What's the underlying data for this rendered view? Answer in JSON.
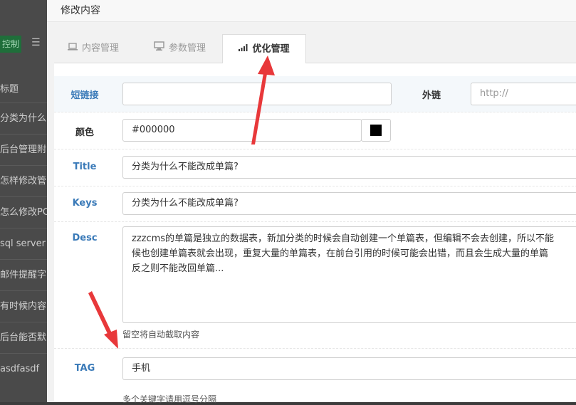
{
  "background": {
    "button_label": "控制",
    "column_header": "标题",
    "rows": [
      "分类为什么",
      "后台管理附",
      "怎样修改管",
      "怎么修改PC",
      "sql server",
      "邮件提醒字",
      "有时候内容",
      "后台能否默",
      "asdfasdf"
    ]
  },
  "modal": {
    "title": "修改内容",
    "tabs": [
      {
        "label": "内容管理",
        "icon": "laptop-icon"
      },
      {
        "label": "参数管理",
        "icon": "desktop-icon"
      },
      {
        "label": "优化管理",
        "icon": "signal-bars-icon"
      }
    ],
    "fields": {
      "shortlink": {
        "label": "短链接",
        "value": ""
      },
      "outlink": {
        "label": "外链",
        "placeholder": "http://"
      },
      "color": {
        "label": "颜色",
        "value": "#000000",
        "swatch": "#000000"
      },
      "title": {
        "label": "Title",
        "value": "分类为什么不能改成单篇?"
      },
      "keys": {
        "label": "Keys",
        "value": "分类为什么不能改成单篇?"
      },
      "desc": {
        "label": "Desc",
        "lines": [
          "zzzcms的单篇是独立的数据表，新加分类的时候会自动创建一个单篇表，但编辑不会去创建，所以不能",
          "候也创建单篇表就会出现，重复大量的单篇表，在前台引用的时候可能会出错，而且会生成大量的单篇",
          "反之则不能改回单篇..."
        ],
        "hint": "留空将自动截取内容"
      },
      "tag": {
        "label": "TAG",
        "value": "手机",
        "hint": "多个关键字请用逗号分隔"
      }
    }
  },
  "colors": {
    "accent_blue": "#3a7ab8",
    "arrow_red": "#e8383a"
  }
}
